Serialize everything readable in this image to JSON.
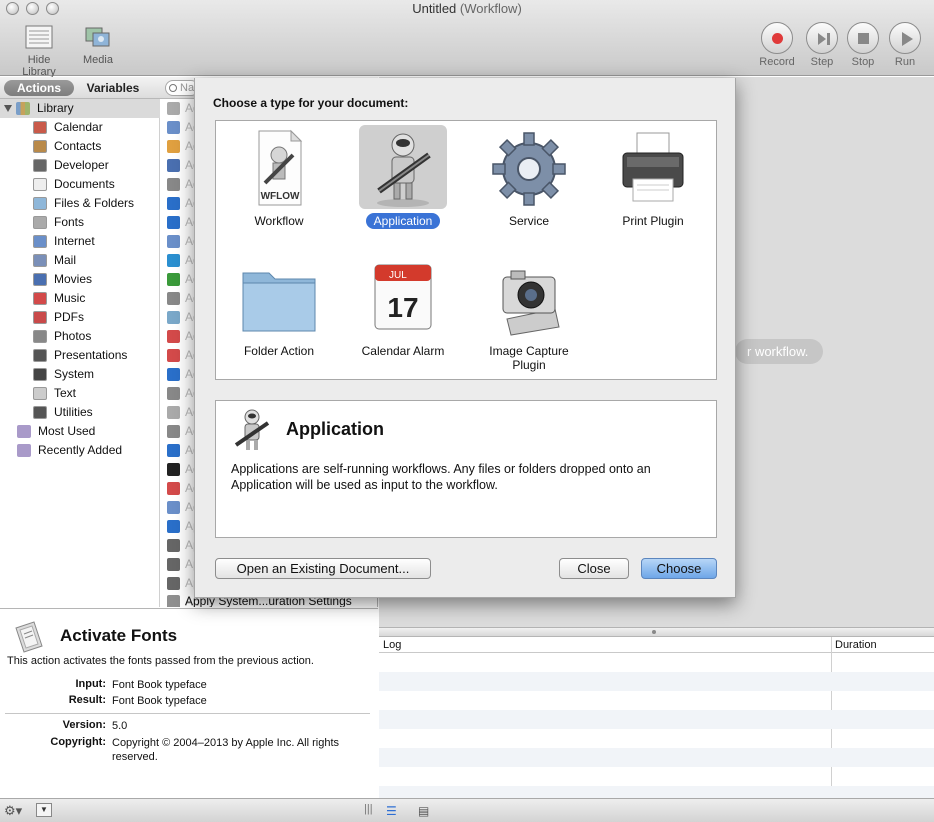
{
  "window": {
    "title": "Untitled",
    "subtitle": "(Workflow)"
  },
  "toolbar": {
    "hide_library": "Hide Library",
    "media": "Media",
    "record": "Record",
    "step": "Step",
    "stop": "Stop",
    "run": "Run"
  },
  "library": {
    "tab_actions": "Actions",
    "tab_variables": "Variables",
    "search_placeholder": "Name",
    "root": "Library",
    "items": [
      "Calendar",
      "Contacts",
      "Developer",
      "Documents",
      "Files & Folders",
      "Fonts",
      "Internet",
      "Mail",
      "Movies",
      "Music",
      "PDFs",
      "Photos",
      "Presentations",
      "System",
      "Text",
      "Utilities"
    ],
    "most_used": "Most Used",
    "recently_added": "Recently Added"
  },
  "actions_list": {
    "rows": [
      "Ad",
      "Ad",
      "Ad",
      "Ad",
      "Ad",
      "Ad",
      "Ad",
      "Ad",
      "Ad",
      "Ad",
      "Ad",
      "Ad",
      "Ad",
      "Ad",
      "Ad",
      "Ad",
      "Ad",
      "Add Columns...to Image Files",
      "Ad",
      "Ad",
      "Ad",
      "Ad",
      "Ap",
      "Ap",
      "Ap",
      "Apply Quartz...er to Image Files",
      "Ap",
      "Ap"
    ],
    "last_row": "Apply System...uration Settings"
  },
  "description": {
    "title": "Activate Fonts",
    "text": "This action activates the fonts passed from the previous action.",
    "input_label": "Input:",
    "input_value": "Font Book typeface",
    "result_label": "Result:",
    "result_value": "Font Book typeface",
    "version_label": "Version:",
    "version_value": "5.0",
    "copyright_label": "Copyright:",
    "copyright_value": "Copyright © 2004–2013 by Apple Inc. All rights reserved."
  },
  "workflow": {
    "drop_hint": "r workflow."
  },
  "log": {
    "col_log": "Log",
    "col_duration": "Duration"
  },
  "sheet": {
    "heading": "Choose a type for your document:",
    "types": [
      {
        "label": "Workflow",
        "icon": "workflow-file-icon",
        "doc_text": "WFLOW"
      },
      {
        "label": "Application",
        "icon": "automator-robot-icon"
      },
      {
        "label": "Service",
        "icon": "gear-icon"
      },
      {
        "label": "Print Plugin",
        "icon": "printer-icon"
      },
      {
        "label": "Folder Action",
        "icon": "folder-icon"
      },
      {
        "label": "Calendar Alarm",
        "icon": "calendar-icon",
        "month": "JUL",
        "day": "17"
      },
      {
        "label": "Image Capture Plugin",
        "icon": "camera-icon"
      }
    ],
    "selected_title": "Application",
    "selected_description": "Applications are self-running workflows. Any files or folders dropped onto an Application will be used as input to the workflow.",
    "open_existing": "Open an Existing Document...",
    "close": "Close",
    "choose": "Choose"
  },
  "colors": {
    "selection_blue": "#3a73d6",
    "choose_button": "#6ea6e8",
    "record_red": "#e03a3a"
  }
}
